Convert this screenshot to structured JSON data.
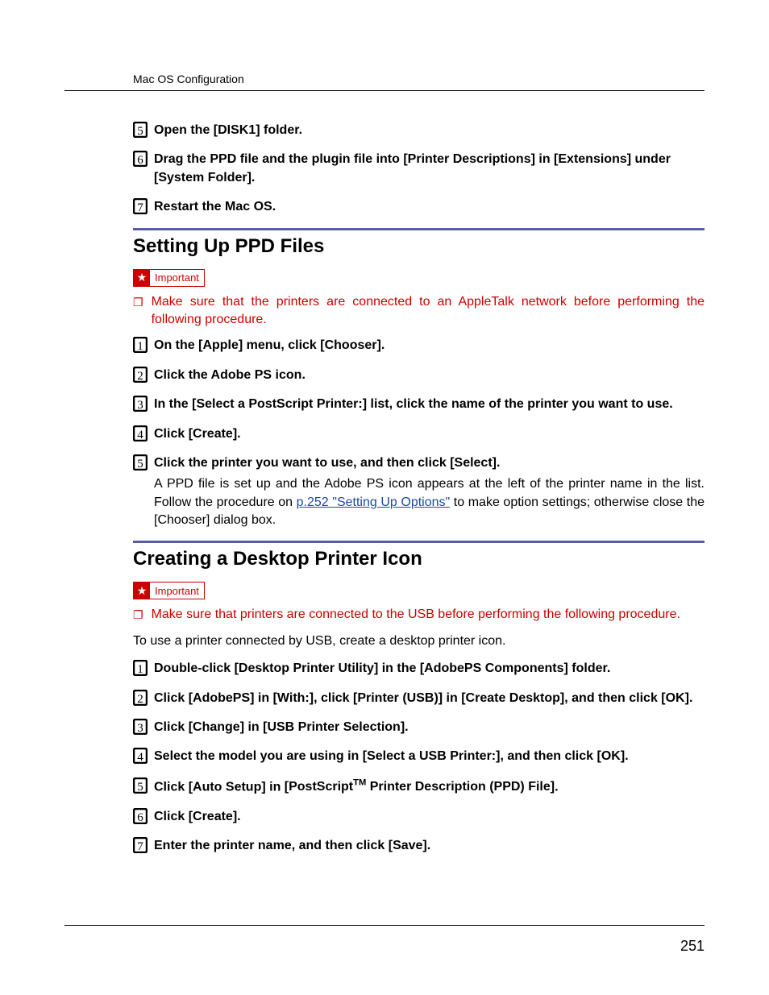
{
  "header": {
    "title": "Mac OS Configuration"
  },
  "labels": {
    "important": "Important"
  },
  "top_steps": {
    "s5": {
      "pre": "Open the ",
      "b1": "[DISK1]",
      "post": " folder."
    },
    "s6": {
      "pre": "Drag the PPD file and the plugin file into ",
      "b1": "[Printer Descriptions]",
      "mid1": " in ",
      "b2": "[Extensions]",
      "mid2": " under ",
      "b3": "[System Folder]",
      "post": "."
    },
    "s7": {
      "text": "Restart the Mac OS."
    }
  },
  "section1": {
    "title": "Setting Up PPD Files",
    "note": "Make sure that the printers are connected to an AppleTalk network before performing the following procedure.",
    "s1": {
      "pre": "On the ",
      "b1": "[Apple]",
      "mid1": " menu, click ",
      "b2": "[Chooser]",
      "post": "."
    },
    "s2": {
      "text": "Click the Adobe PS icon."
    },
    "s3": {
      "pre": "In the ",
      "b1": "[Select a PostScript Printer:]",
      "post": " list, click the name of the printer you want to use."
    },
    "s4": {
      "pre": "Click ",
      "b1": "[Create]",
      "post": "."
    },
    "s5": {
      "pre": "Click the printer you want to use, and then click ",
      "b1": "[Select]",
      "post": ".",
      "sub_pre": "A PPD file is set up and the Adobe PS icon appears at the left of the printer name in the list. Follow the procedure on ",
      "link": "p.252 \"Setting Up Options\"",
      "sub_mid": " to make option settings; otherwise close the ",
      "sub_b1": "[Chooser]",
      "sub_post": " dialog box."
    }
  },
  "section2": {
    "title": "Creating a Desktop Printer Icon",
    "note": "Make sure that printers are connected to the USB before performing the following procedure.",
    "intro": "To use a printer connected by USB, create a desktop printer icon.",
    "s1": {
      "pre": "Double-click ",
      "b1": "[Desktop Printer Utility]",
      "mid1": " in the ",
      "b2": "[AdobePS Components]",
      "post": " folder."
    },
    "s2": {
      "pre": "Click ",
      "b1": "[AdobePS]",
      "mid1": " in ",
      "b2": "[With:]",
      "mid2": ", click ",
      "b3": "[Printer (USB)]",
      "mid3": " in ",
      "b4": "[Create Desktop]",
      "mid4": ", and then click ",
      "b5": "[OK]",
      "post": "."
    },
    "s3": {
      "pre": "Click ",
      "b1": "[Change]",
      "mid1": " in ",
      "b2": "[USB Printer Selection]",
      "post": "."
    },
    "s4": {
      "pre": "Select the model you are using in ",
      "b1": "[Select a USB Printer:]",
      "mid1": ", and then click ",
      "b2": "[OK]",
      "post": "."
    },
    "s5": {
      "pre": "Click ",
      "b1": "[Auto Setup]",
      "mid1": " in ",
      "b2_pre": "[PostScript",
      "b2_post": " Printer Description (PPD) File]",
      "post": "."
    },
    "s6": {
      "pre": "Click ",
      "b1": "[Create]",
      "post": "."
    },
    "s7": {
      "pre": "Enter the printer name, and then click ",
      "b1": "[Save]",
      "post": "."
    }
  },
  "page_number": "251"
}
